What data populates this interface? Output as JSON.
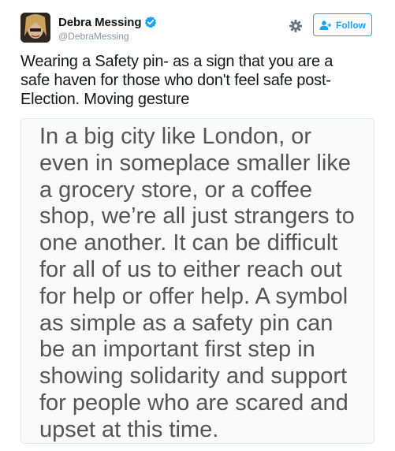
{
  "tweet": {
    "display_name": "Debra Messing",
    "handle": "@DebraMessing",
    "verified": true,
    "follow_label": "Follow",
    "text_lines": [
      "Wearing a Safety pin- as a sign that you are a",
      "safe haven for those who don't feel safe post-",
      "Election. Moving gesture"
    ],
    "image_text_lines": [
      "In a big city like London, or",
      "even in someplace smaller like",
      "a grocery store, or a coffee",
      "shop, we’re all just strangers to",
      "one another. It can be difficult",
      "for all of us to either reach out",
      "for help or offer help. A symbol",
      "as simple as a safety pin can",
      "be an important first step in",
      "showing solidarity and support",
      "for people who are scared and",
      "upset at this time."
    ]
  },
  "icons": {
    "verified": "verified-badge-icon",
    "settings": "gear-icon",
    "follow": "add-user-icon"
  },
  "colors": {
    "accent": "#1da1f2",
    "name": "#14171a",
    "handle": "#8899a6",
    "image_text": "#555555",
    "image_background": "#fafafa"
  }
}
